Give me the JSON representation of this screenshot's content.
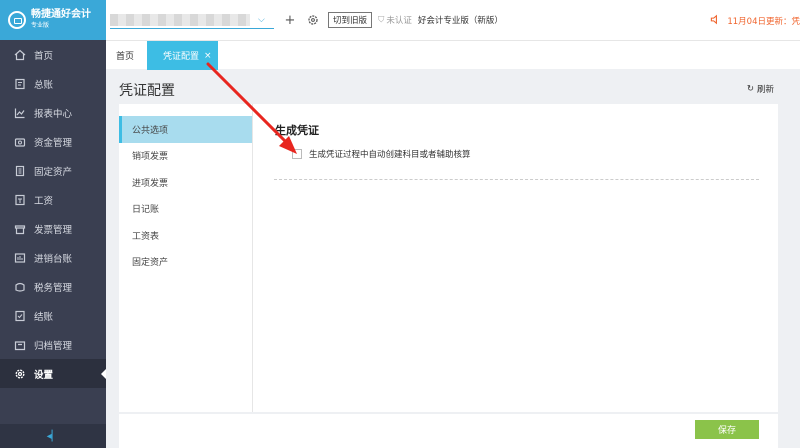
{
  "app": {
    "logo_title": "畅捷通好会计",
    "logo_subtitle": "专业版"
  },
  "sidebar": {
    "items": [
      {
        "label": "首页",
        "icon": "home-icon"
      },
      {
        "label": "总账",
        "icon": "ledger-icon"
      },
      {
        "label": "报表中心",
        "icon": "chart-icon"
      },
      {
        "label": "资金管理",
        "icon": "money-icon"
      },
      {
        "label": "固定资产",
        "icon": "building-icon"
      },
      {
        "label": "工资",
        "icon": "payroll-icon"
      },
      {
        "label": "发票管理",
        "icon": "invoice-icon"
      },
      {
        "label": "进销台账",
        "icon": "stock-icon"
      },
      {
        "label": "税务管理",
        "icon": "tax-icon"
      },
      {
        "label": "结账",
        "icon": "close-books-icon"
      },
      {
        "label": "归档管理",
        "icon": "archive-icon"
      },
      {
        "label": "设置",
        "icon": "gear-icon",
        "active": true
      }
    ],
    "collapse_icon": "collapse-icon"
  },
  "topbar": {
    "switch_label": "切到旧版",
    "cert_label": "未认证",
    "edition_label": "好会计专业版（新版）",
    "update_label": "11月04日更新：凭"
  },
  "tabs": {
    "home": "首页",
    "active": "凭证配置",
    "close": "×"
  },
  "page": {
    "title": "凭证配置",
    "refresh_label": "刷新"
  },
  "subnav": {
    "items": [
      "公共选项",
      "销项发票",
      "进项发票",
      "日记账",
      "工资表",
      "固定资产"
    ]
  },
  "content": {
    "section_title": "生成凭证",
    "option_label": "生成凭证过程中自动创建科目或者辅助核算"
  },
  "footer": {
    "save_label": "保存"
  },
  "colors": {
    "sidebar_bg": "#3a3f51",
    "accent": "#3dbde4",
    "save_green": "#8bc34a",
    "update_orange": "#f0642d",
    "annotation_red": "#e8261f"
  }
}
